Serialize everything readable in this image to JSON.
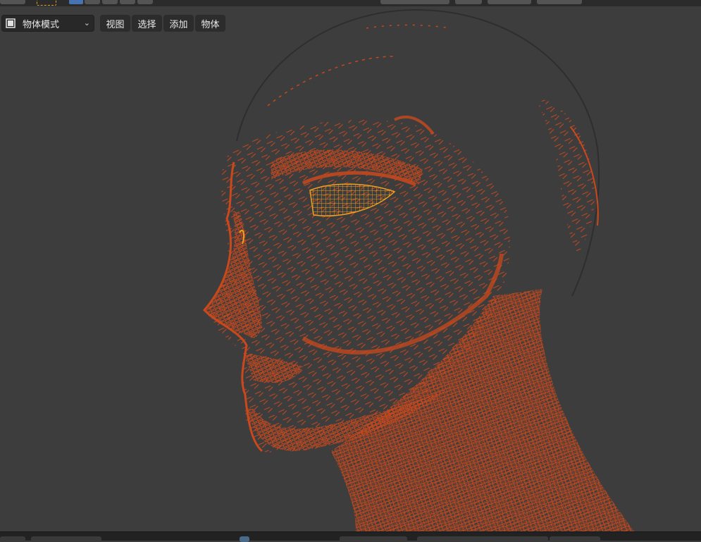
{
  "header": {
    "mode_label": "物体模式",
    "menu": [
      "视图",
      "选择",
      "添加",
      "物体"
    ]
  },
  "icons": {
    "mode": "object-mode-icon",
    "caret": "chevron-down-icon"
  },
  "colors": {
    "viewport_bg": "#3d3d3d",
    "wire": "#c9481c",
    "wire_highlight": "#f0a020",
    "header_button": "#2c2c2c",
    "accent_select": "#4772b3"
  }
}
